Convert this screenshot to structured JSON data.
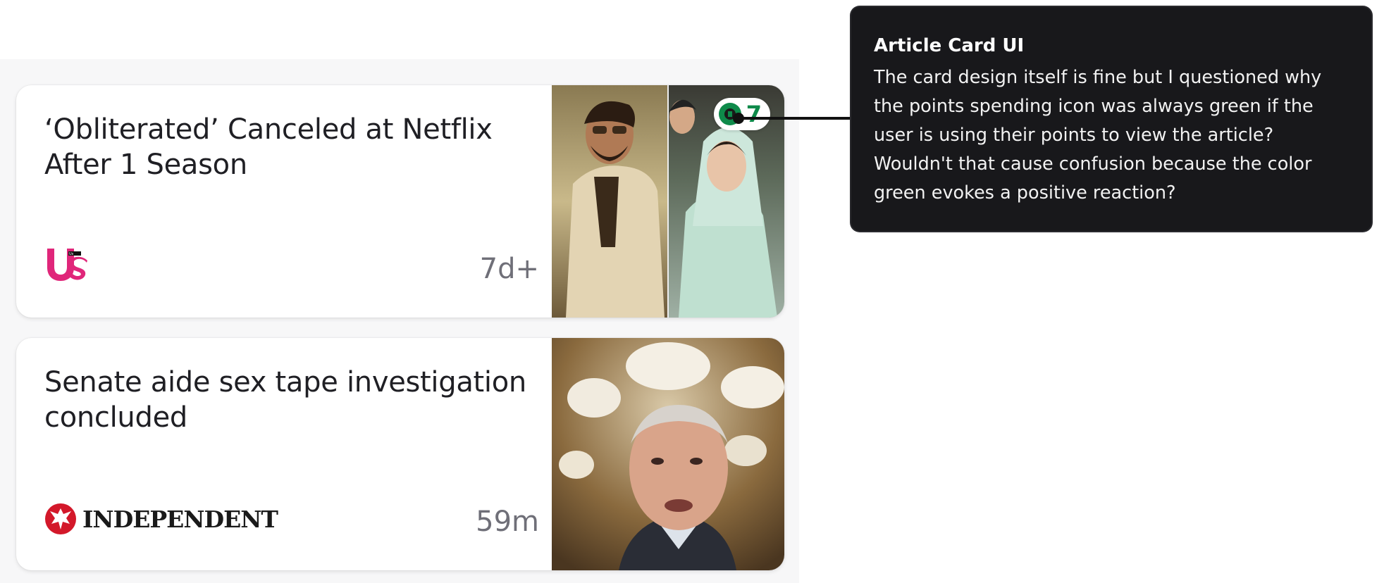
{
  "articles": [
    {
      "headline": "‘Obliterated’ Canceled at Netflix After 1 Season",
      "source": "Us",
      "source_logo_icon": "us-weekly-logo",
      "age": "7d+",
      "points_cost": "7",
      "points_icon": "points-coin-icon",
      "points_color": "#0e8a4a"
    },
    {
      "headline": "Senate aide sex tape investigation concluded",
      "source": "INDEPENDENT",
      "source_logo_icon": "independent-eagle-logo",
      "age": "59m"
    }
  ],
  "annotation": {
    "title": "Article Card UI",
    "body": "The card design itself is fine but I questioned why the points spending icon was always green if the user is using their points to view the article? Wouldn't that cause confusion because the color green evokes a positive reaction?"
  },
  "colors": {
    "us_brand": "#e0267a",
    "independent_red": "#d3182a",
    "tooltip_bg": "#18181b"
  }
}
